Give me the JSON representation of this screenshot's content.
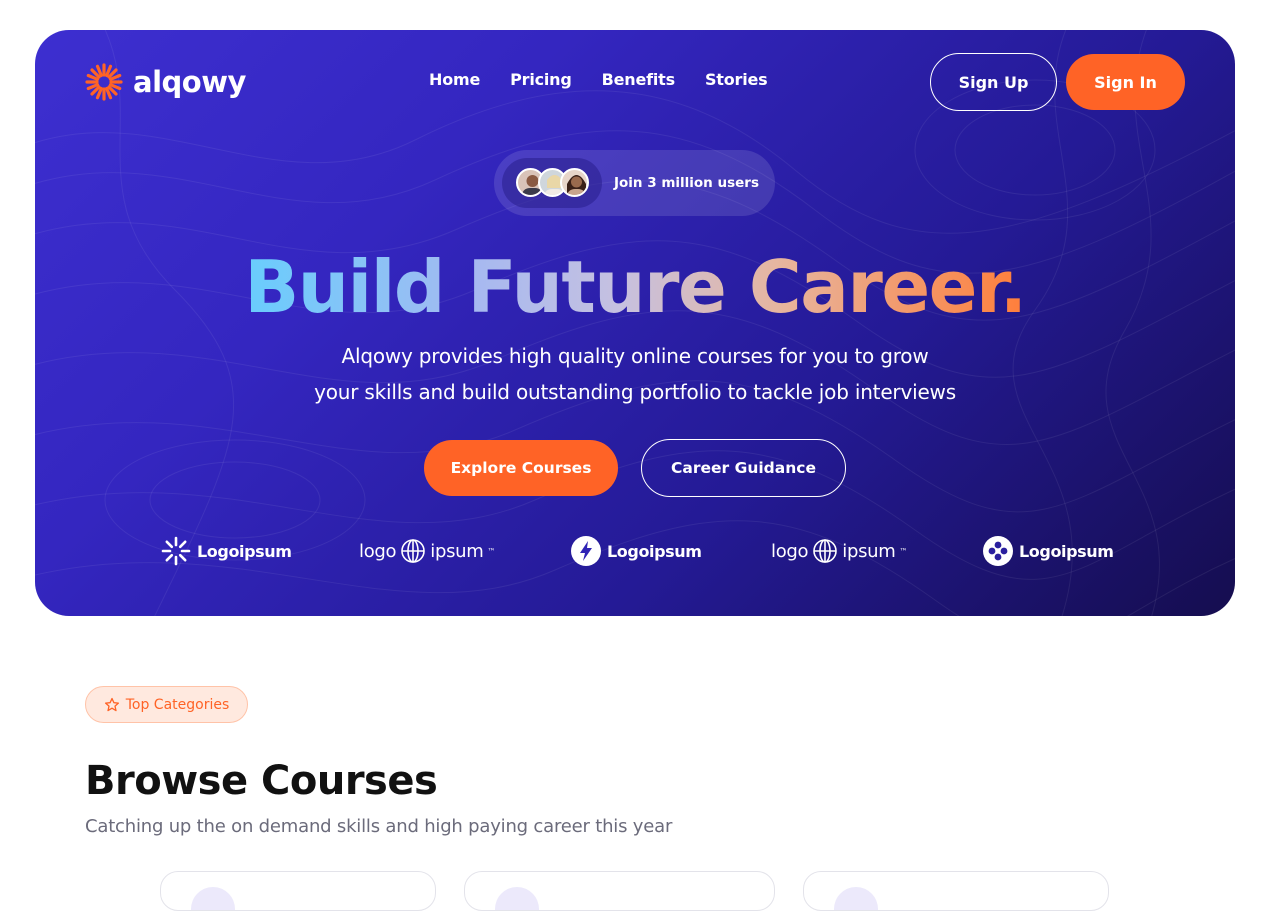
{
  "brand": {
    "name": "alqowy",
    "accent": "#ff6326",
    "hero_bg": "#3426c0"
  },
  "nav": {
    "items": [
      "Home",
      "Pricing",
      "Benefits",
      "Stories"
    ]
  },
  "auth": {
    "signup_label": "Sign Up",
    "signin_label": "Sign In"
  },
  "hero": {
    "join_text": "Join 3 million users",
    "headline": "Build Future Career.",
    "sub_line1": "Alqowy provides high quality online courses for you to grow",
    "sub_line2": "your skills and build outstanding portfolio to tackle job interviews",
    "cta_primary": "Explore Courses",
    "cta_secondary": "Career Guidance"
  },
  "partners": [
    {
      "text": "Logoipsum",
      "icon": "sunburst-logo-icon"
    },
    {
      "text_left": "logo",
      "text_right": "ipsum",
      "icon": "globe-logo-icon"
    },
    {
      "text": "Logoipsum",
      "icon": "bolt-logo-icon"
    },
    {
      "text_left": "logo",
      "text_right": "ipsum",
      "icon": "globe-logo-icon"
    },
    {
      "text": "Logoipsum",
      "icon": "dots-logo-icon"
    }
  ],
  "categories": {
    "badge": "Top Categories",
    "title": "Browse Courses",
    "subtitle": "Catching up the on demand skills and high paying career this year"
  }
}
